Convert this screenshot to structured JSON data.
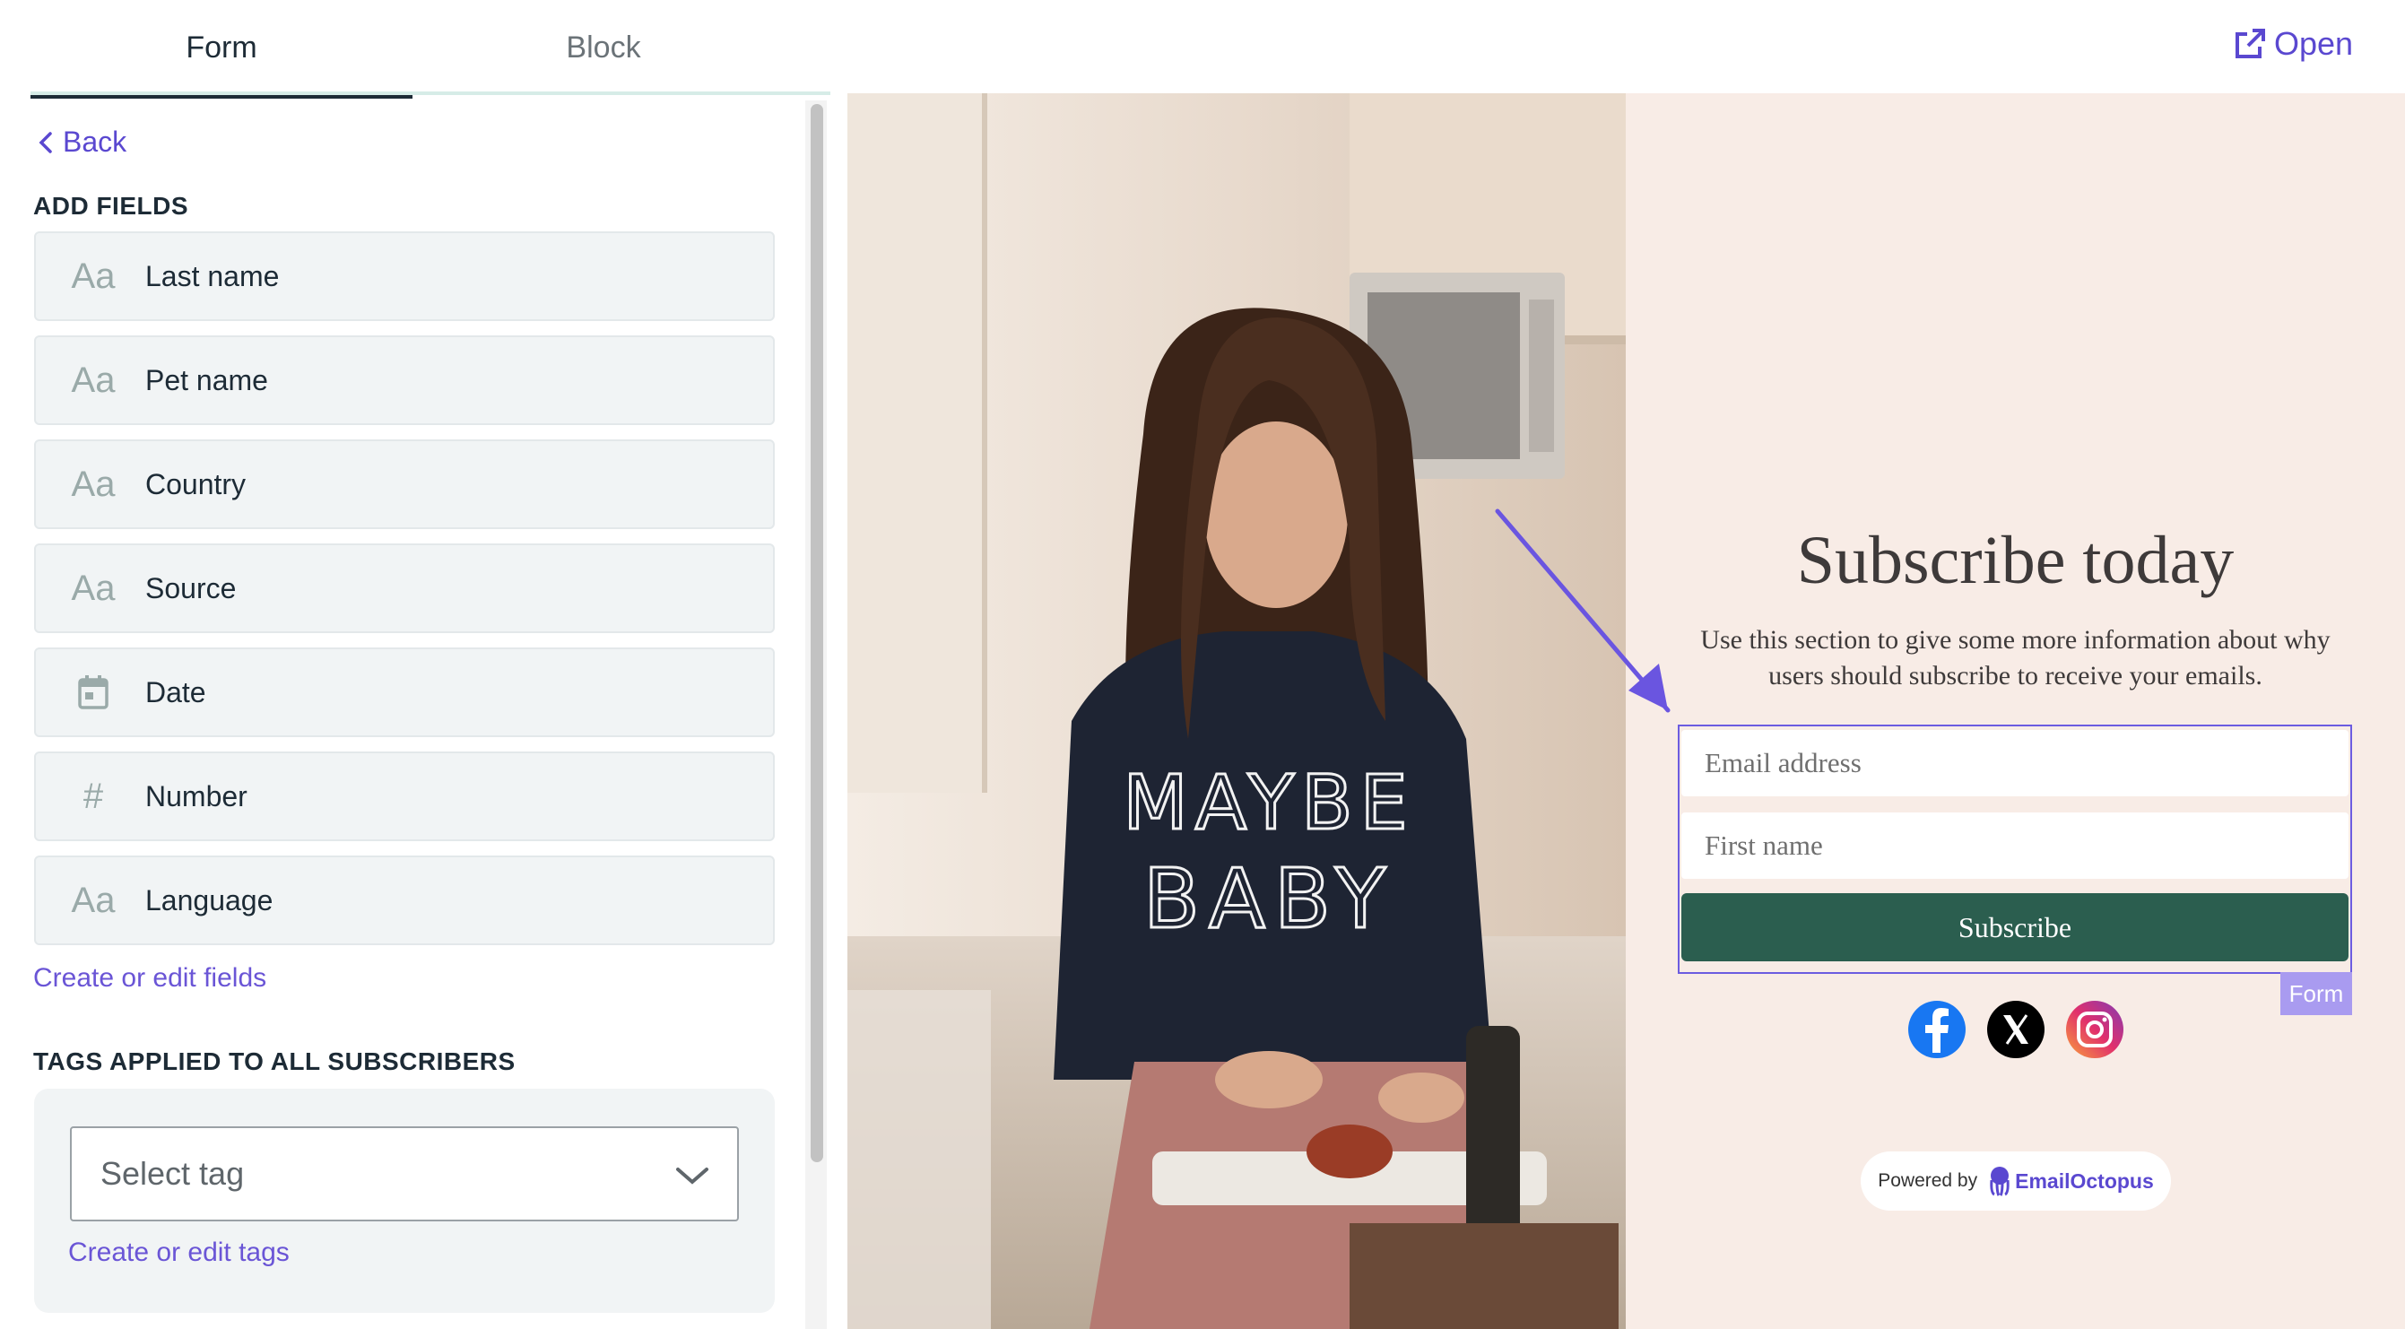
{
  "tabs": {
    "form": "Form",
    "block": "Block"
  },
  "header": {
    "open_label": "Open"
  },
  "sidebar": {
    "back_label": "Back",
    "add_fields_heading": "ADD FIELDS",
    "fields": [
      {
        "label": "Last name",
        "icon": "text-field-icon"
      },
      {
        "label": "Pet name",
        "icon": "text-field-icon"
      },
      {
        "label": "Country",
        "icon": "text-field-icon"
      },
      {
        "label": "Source",
        "icon": "text-field-icon"
      },
      {
        "label": "Date",
        "icon": "calendar-icon"
      },
      {
        "label": "Number",
        "icon": "hash-icon"
      },
      {
        "label": "Language",
        "icon": "text-field-icon"
      }
    ],
    "text_icon_glyph": "Aa",
    "hash_glyph": "#",
    "create_fields_link": "Create or edit fields",
    "tags_heading": "TAGS APPLIED TO ALL SUBSCRIBERS",
    "tag_select_value": "Select tag",
    "create_tags_link": "Create or edit tags"
  },
  "preview": {
    "title": "Subscribe today",
    "description": "Use this section to give some more information about why users should subscribe to receive your emails.",
    "email_placeholder": "Email address",
    "firstname_placeholder": "First name",
    "subscribe_label": "Subscribe",
    "form_tag": "Form",
    "powered_by": "Powered by",
    "brand": "EmailOctopus",
    "shirt_text_line1": "MAYBE",
    "shirt_text_line2": "BABY"
  },
  "colors": {
    "accent": "#5a48d0",
    "button": "#2b5e4f",
    "preview_bg": "#f8ece6"
  }
}
